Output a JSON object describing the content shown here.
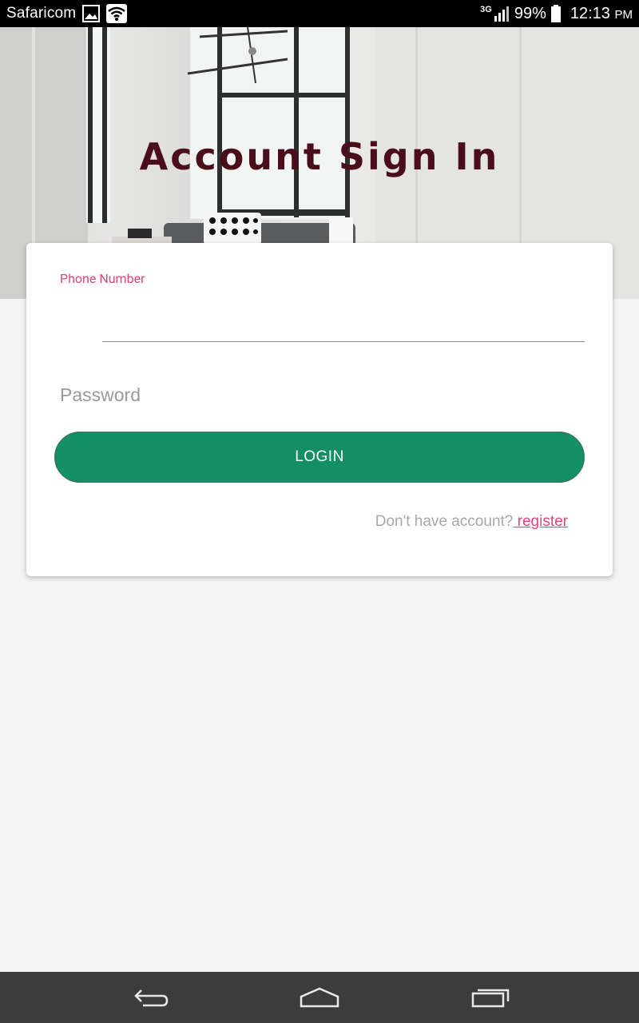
{
  "status_bar": {
    "carrier": "Safaricom",
    "network_type": "3G",
    "battery": "99%",
    "time": "12:13",
    "period": "PM"
  },
  "hero": {
    "title": "Account Sign In"
  },
  "form": {
    "phone_label": "Phone Number",
    "phone_value": "",
    "password_placeholder": "Password",
    "login_label": "LOGIN",
    "no_account_text": "Don't have account?",
    "register_label": " register"
  },
  "colors": {
    "accent": "#e0457b",
    "primary_button": "#138f65",
    "title": "#4a0d1c"
  }
}
